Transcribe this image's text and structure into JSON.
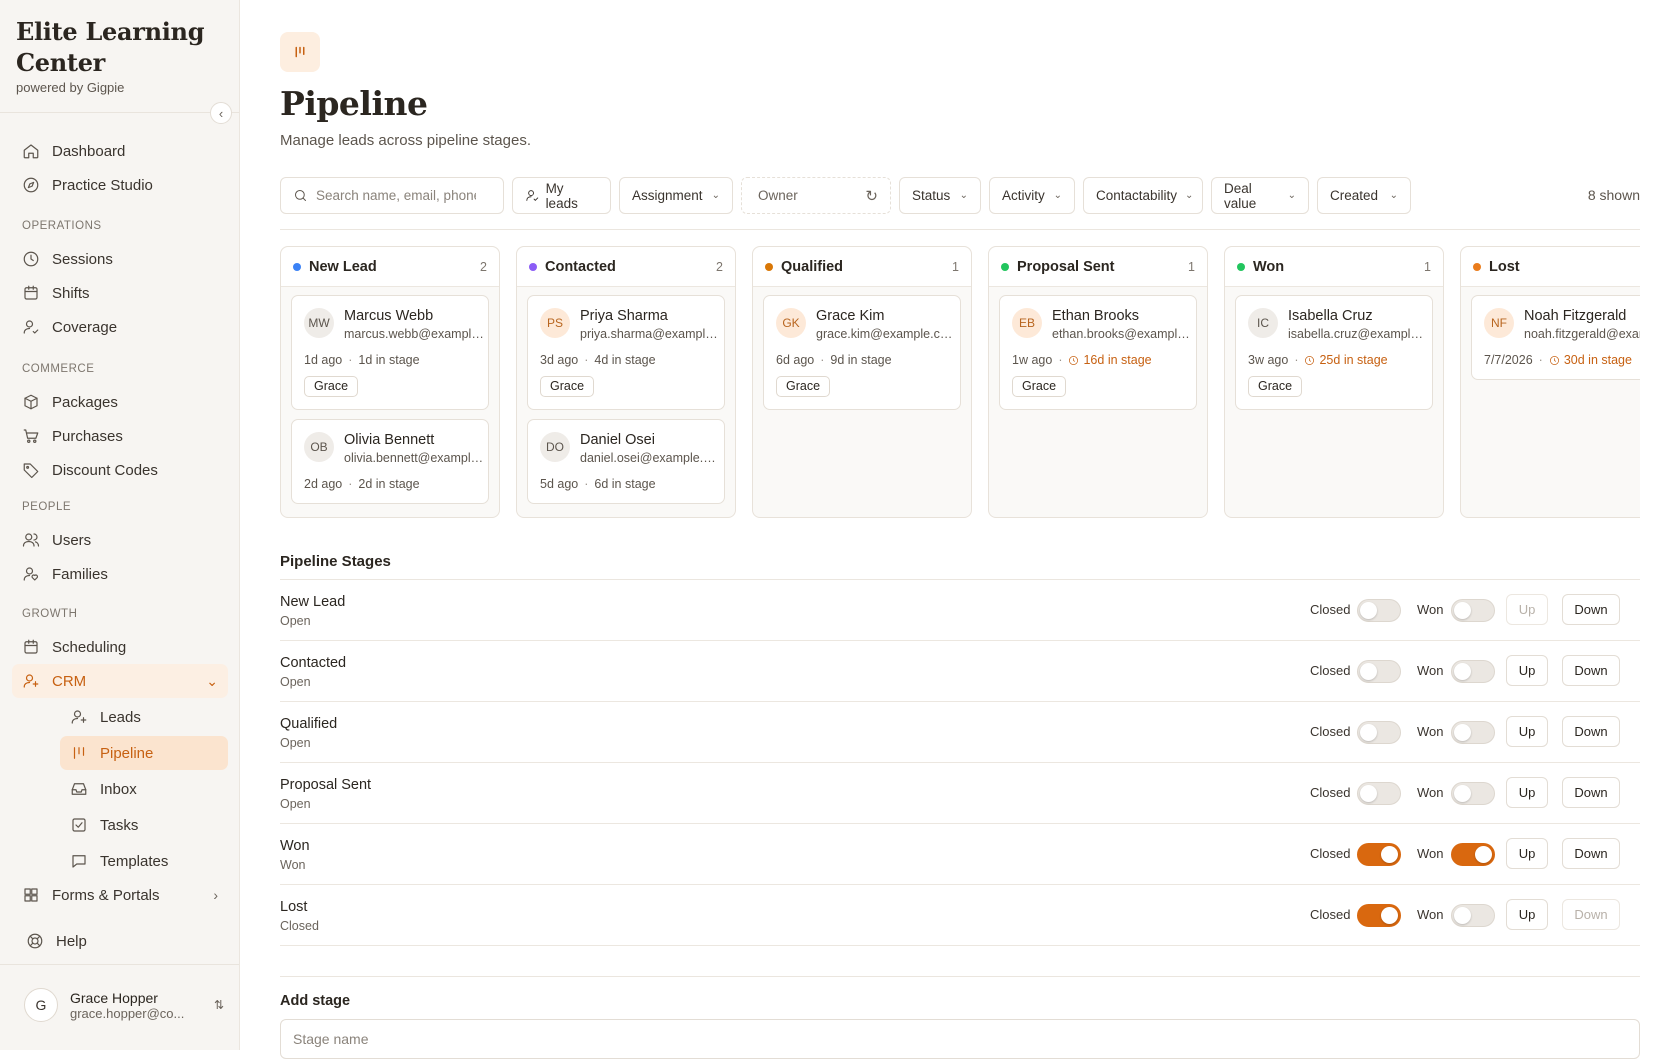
{
  "brand": {
    "title": "Elite Learning Center",
    "subtitle": "powered by Gigpie"
  },
  "nav": {
    "dashboard": "Dashboard",
    "practice_studio": "Practice Studio",
    "sec_operations": "OPERATIONS",
    "sessions": "Sessions",
    "shifts": "Shifts",
    "coverage": "Coverage",
    "sec_commerce": "COMMERCE",
    "packages": "Packages",
    "purchases": "Purchases",
    "discount_codes": "Discount Codes",
    "sec_people": "PEOPLE",
    "users": "Users",
    "families": "Families",
    "sec_growth": "GROWTH",
    "scheduling": "Scheduling",
    "crm": "CRM",
    "leads": "Leads",
    "pipeline": "Pipeline",
    "inbox": "Inbox",
    "tasks": "Tasks",
    "templates": "Templates",
    "forms_portals": "Forms & Portals",
    "help": "Help"
  },
  "user": {
    "initial": "G",
    "name": "Grace Hopper",
    "email": "grace.hopper@co..."
  },
  "page": {
    "title": "Pipeline",
    "subtitle": "Manage leads across pipeline stages."
  },
  "filters": {
    "search_placeholder": "Search name, email, phone",
    "my_leads": "My leads",
    "assignment": "Assignment",
    "owner": "Owner",
    "status": "Status",
    "activity": "Activity",
    "contactability": "Contactability",
    "deal_value": "Deal value",
    "created": "Created",
    "shown": "8 shown"
  },
  "columns": [
    {
      "name": "New Lead",
      "count": "2",
      "color": "#3b82f6",
      "cards": [
        {
          "initials": "MW",
          "name": "Marcus Webb",
          "email": "marcus.webb@example.com",
          "age": "1d ago",
          "stage_time": "1d in stage",
          "owner": "Grace"
        },
        {
          "initials": "OB",
          "name": "Olivia Bennett",
          "email": "olivia.bennett@example.com",
          "age": "2d ago",
          "stage_time": "2d in stage"
        }
      ]
    },
    {
      "name": "Contacted",
      "count": "2",
      "color": "#8b5cf6",
      "cards": [
        {
          "initials": "PS",
          "name": "Priya Sharma",
          "email": "priya.sharma@example.com",
          "age": "3d ago",
          "stage_time": "4d in stage",
          "owner": "Grace"
        },
        {
          "initials": "DO",
          "name": "Daniel Osei",
          "email": "daniel.osei@example.com",
          "age": "5d ago",
          "stage_time": "6d in stage"
        }
      ]
    },
    {
      "name": "Qualified",
      "count": "1",
      "color": "#d97706",
      "cards": [
        {
          "initials": "GK",
          "name": "Grace Kim",
          "email": "grace.kim@example.com",
          "age": "6d ago",
          "stage_time": "9d in stage",
          "owner": "Grace"
        }
      ]
    },
    {
      "name": "Proposal Sent",
      "count": "1",
      "color": "#22c55e",
      "cards": [
        {
          "initials": "EB",
          "name": "Ethan Brooks",
          "email": "ethan.brooks@example.com",
          "age": "1w ago",
          "stage_time": "16d in stage",
          "owner": "Grace"
        }
      ]
    },
    {
      "name": "Won",
      "count": "1",
      "color": "#22c55e",
      "cards": [
        {
          "initials": "IC",
          "name": "Isabella Cruz",
          "email": "isabella.cruz@example.com",
          "age": "3w ago",
          "stage_time": "25d in stage",
          "owner": "Grace"
        }
      ]
    },
    {
      "name": "Lost",
      "count": "",
      "color": "#ea7c1c",
      "cards": [
        {
          "initials": "NF",
          "name": "Noah Fitzgerald",
          "email": "noah.fitzgerald@example.com",
          "age": "7/7/2026",
          "stage_time": "30d in stage"
        }
      ]
    }
  ],
  "stages": {
    "title": "Pipeline Stages",
    "closed_label": "Closed",
    "won_label": "Won",
    "up_label": "Up",
    "down_label": "Down",
    "rows": [
      {
        "name": "New Lead",
        "kind": "Open",
        "closed": false,
        "won": false
      },
      {
        "name": "Contacted",
        "kind": "Open",
        "closed": false,
        "won": false
      },
      {
        "name": "Qualified",
        "kind": "Open",
        "closed": false,
        "won": false
      },
      {
        "name": "Proposal Sent",
        "kind": "Open",
        "closed": false,
        "won": false
      },
      {
        "name": "Won",
        "kind": "Won",
        "closed": true,
        "won": true
      },
      {
        "name": "Lost",
        "kind": "Closed",
        "closed": true,
        "won": false
      }
    ]
  },
  "add_stage": {
    "title": "Add stage",
    "placeholder": "Stage name"
  },
  "accent": "#d9680f"
}
